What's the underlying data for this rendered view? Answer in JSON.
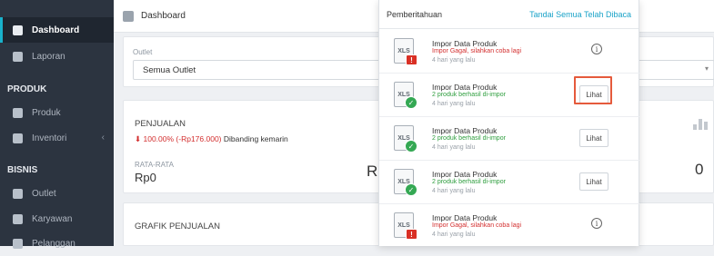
{
  "sidebar": {
    "items": [
      {
        "label": "Dashboard",
        "icon": "dashboard-icon"
      },
      {
        "label": "Laporan",
        "icon": "report-icon"
      },
      {
        "label": "Produk",
        "icon": "product-icon"
      },
      {
        "label": "Inventori",
        "icon": "inventory-icon"
      },
      {
        "label": "Outlet",
        "icon": "outlet-icon"
      },
      {
        "label": "Karyawan",
        "icon": "employee-icon"
      },
      {
        "label": "Pelanggan",
        "icon": "customer-icon"
      }
    ],
    "sections": {
      "produk": "PRODUK",
      "bisnis": "BISNIS"
    }
  },
  "header": {
    "title": "Dashboard"
  },
  "outlet": {
    "label": "Outlet",
    "value": "Semua Outlet"
  },
  "sales": {
    "title": "PENJUALAN",
    "change": "100.00% (-Rp176.000)",
    "compare": "Dibanding kemarin",
    "avg_label": "RATA-RATA",
    "avg_value": "Rp0",
    "right_value": "0",
    "partial_value": "R"
  },
  "chart_panel": {
    "title": "GRAFIK PENJUALAN"
  },
  "notifications": {
    "title": "Pemberitahuan",
    "mark_all_read": "Tandai Semua Telah Dibaca",
    "items": [
      {
        "file": "XLS",
        "title": "Impor Data Produk",
        "desc": "Impor Gagal, silahkan coba lagi",
        "time": "4 hari yang lalu",
        "status": "failed"
      },
      {
        "file": "XLS",
        "title": "Impor Data Produk",
        "desc": "2 produk berhasil di-impor",
        "time": "4 hari yang lalu",
        "status": "success",
        "action": "Lihat"
      },
      {
        "file": "XLS",
        "title": "Impor Data Produk",
        "desc": "2 produk berhasil di-impor",
        "time": "4 hari yang lalu",
        "status": "success",
        "action": "Lihat"
      },
      {
        "file": "XLS",
        "title": "Impor Data Produk",
        "desc": "2 produk berhasil di-impor",
        "time": "4 hari yang lalu",
        "status": "success",
        "action": "Lihat"
      },
      {
        "file": "XLS",
        "title": "Impor Data Produk",
        "desc": "Impor Gagal, silahkan coba lagi",
        "time": "4 hari yang lalu",
        "status": "failed"
      }
    ]
  },
  "colors": {
    "accent": "#1aa3c8",
    "error": "#d32f2f",
    "success": "#2e9e3e",
    "highlight": "#e55a3c",
    "sidebar_bg": "#2c3440"
  }
}
